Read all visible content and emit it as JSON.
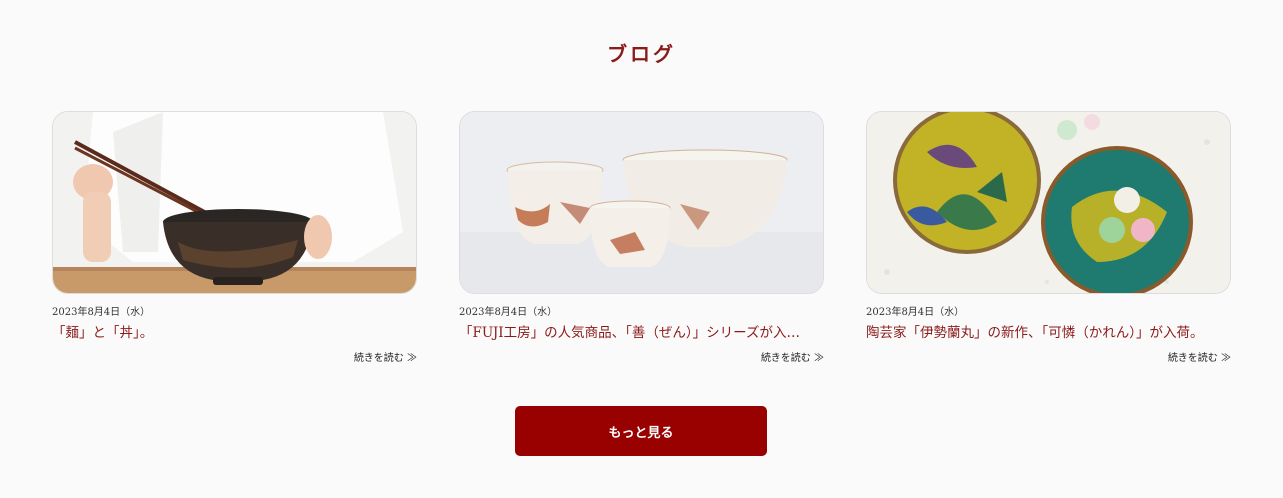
{
  "section": {
    "title": "ブログ"
  },
  "posts": [
    {
      "date": "2023年8月4日（水）",
      "title": "「麺」と「丼」。",
      "read_more": "続きを読む ≫",
      "image": "person-holding-ramen-bowl-with-chopsticks"
    },
    {
      "date": "2023年8月4日（水）",
      "title": "「FUJI工房」の人気商品、「善（ぜん）」シリーズが入…",
      "read_more": "続きを読む ≫",
      "image": "white-ceramic-cups-and-bowl-with-rust-glaze"
    },
    {
      "date": "2023年8月4日（水）",
      "title": "陶芸家「伊勢蘭丸」の新作、「可憐（かれん）」が入荷。",
      "read_more": "続きを読む ≫",
      "image": "kutani-plates-with-wagashi"
    }
  ],
  "more_button": {
    "label": "もっと見る"
  },
  "colors": {
    "accent": "#990000",
    "title": "#8b1a1a",
    "background": "#fafafa"
  }
}
